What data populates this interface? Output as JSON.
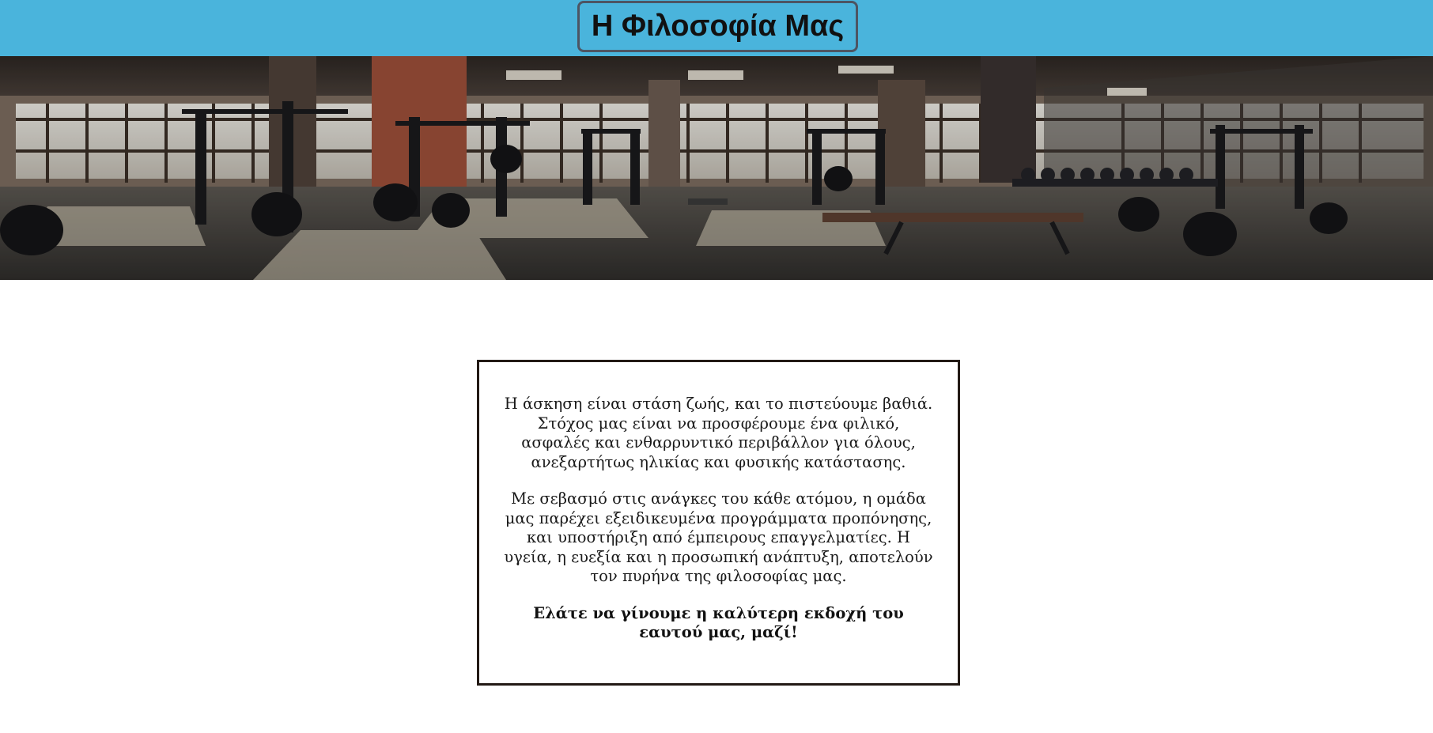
{
  "header": {
    "title": "Η Φιλοσοφία Μας",
    "background_color": "#4ab4dc"
  },
  "hero": {
    "image": "gym-interior-banner"
  },
  "content": {
    "paragraph1": "Η άσκηση είναι στάση ζωής, και το πιστεύουμε βαθιά. Στόχος μας είναι να προσφέρουμε ένα φιλικό, ασφαλές και ενθαρρυντικό περιβάλλον για όλους, ανεξαρτήτως ηλικίας και φυσικής κατάστασης.",
    "paragraph2": "Με σεβασμό στις ανάγκες του κάθε ατόμου, η ομάδα μας παρέχει εξειδικευμένα προγράμματα προπόνησης, και υποστήριξη από έμπειρους επαγγελματίες. Η υγεία, η ευεξία και η προσωπική ανάπτυξη, αποτελούν τον πυρήνα της φιλοσοφίας μας.",
    "closing": "Ελάτε να γίνουμε η καλύτερη εκδοχή του εαυτού μας, μαζί!"
  }
}
